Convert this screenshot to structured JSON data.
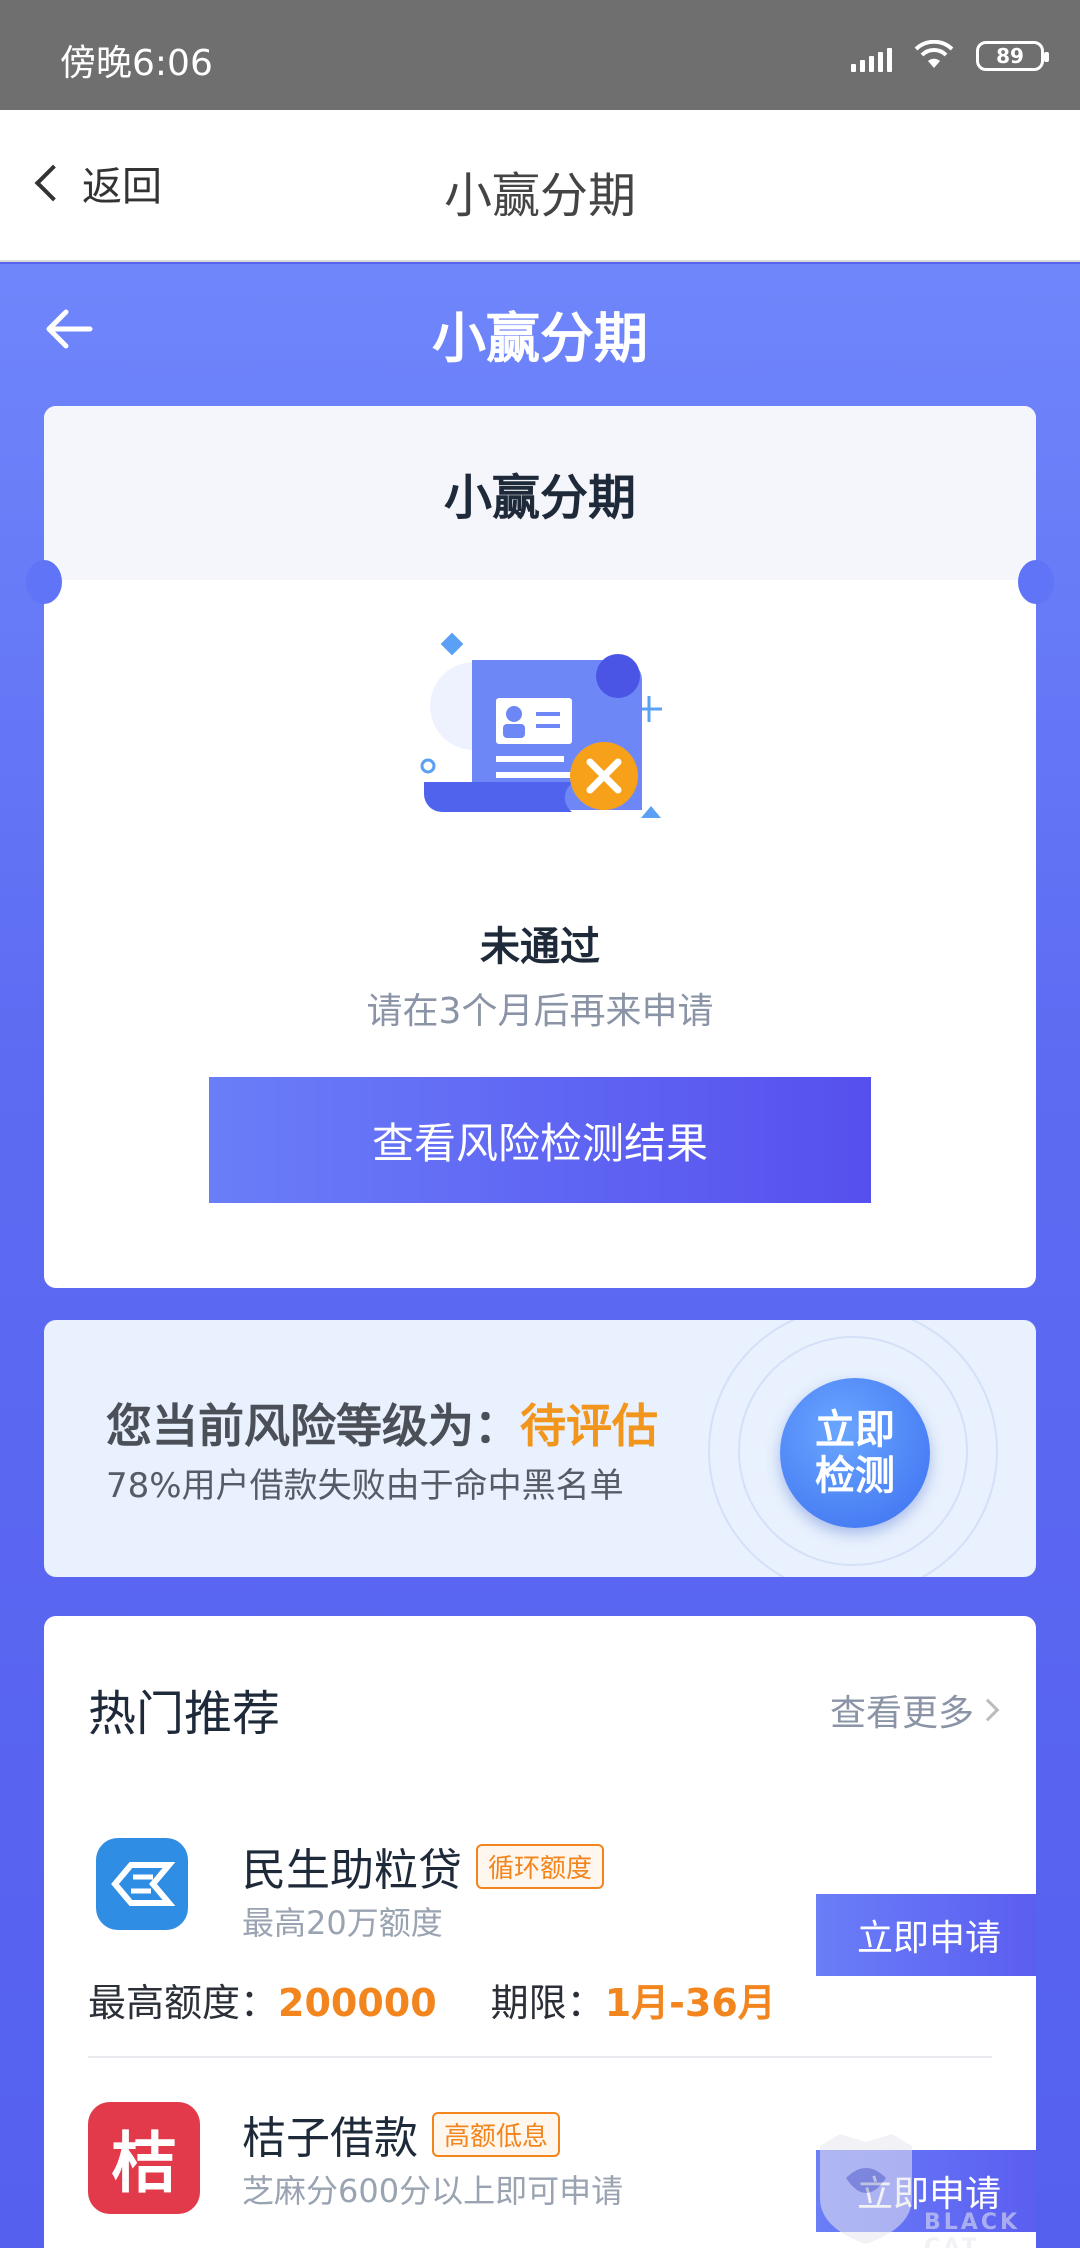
{
  "status_bar": {
    "time": "傍晚6:06",
    "battery": "89"
  },
  "nav": {
    "back_label": "返回",
    "title": "小赢分期"
  },
  "header": {
    "title": "小赢分期"
  },
  "result": {
    "card_title": "小赢分期",
    "status": "未通过",
    "message": "请在3个月后再来申请",
    "button": "查看风险检测结果"
  },
  "risk": {
    "label": "您当前风险等级为：",
    "level": "待评估",
    "note": "78%用户借款失败由于命中黑名单",
    "button_line1": "立即",
    "button_line2": "检测"
  },
  "recommend": {
    "title": "热门推荐",
    "more": "查看更多",
    "items": [
      {
        "name": "民生助粒贷",
        "tag": "循环额度",
        "desc": "最高20万额度",
        "button": "立即申请",
        "amount_label": "最高额度：",
        "amount": "200000",
        "term_label": "期限：",
        "term": "1月-36月"
      },
      {
        "name": "桔子借款",
        "tag": "高额低息",
        "desc": "芝麻分600分以上即可申请",
        "button": "立即申请",
        "logo_char": "桔"
      }
    ]
  },
  "watermark": {
    "text": "BLACK CAT"
  },
  "colors": {
    "accent": "#5a63ee",
    "highlight": "#f2951d",
    "status_bar": "#6f6f6f"
  }
}
